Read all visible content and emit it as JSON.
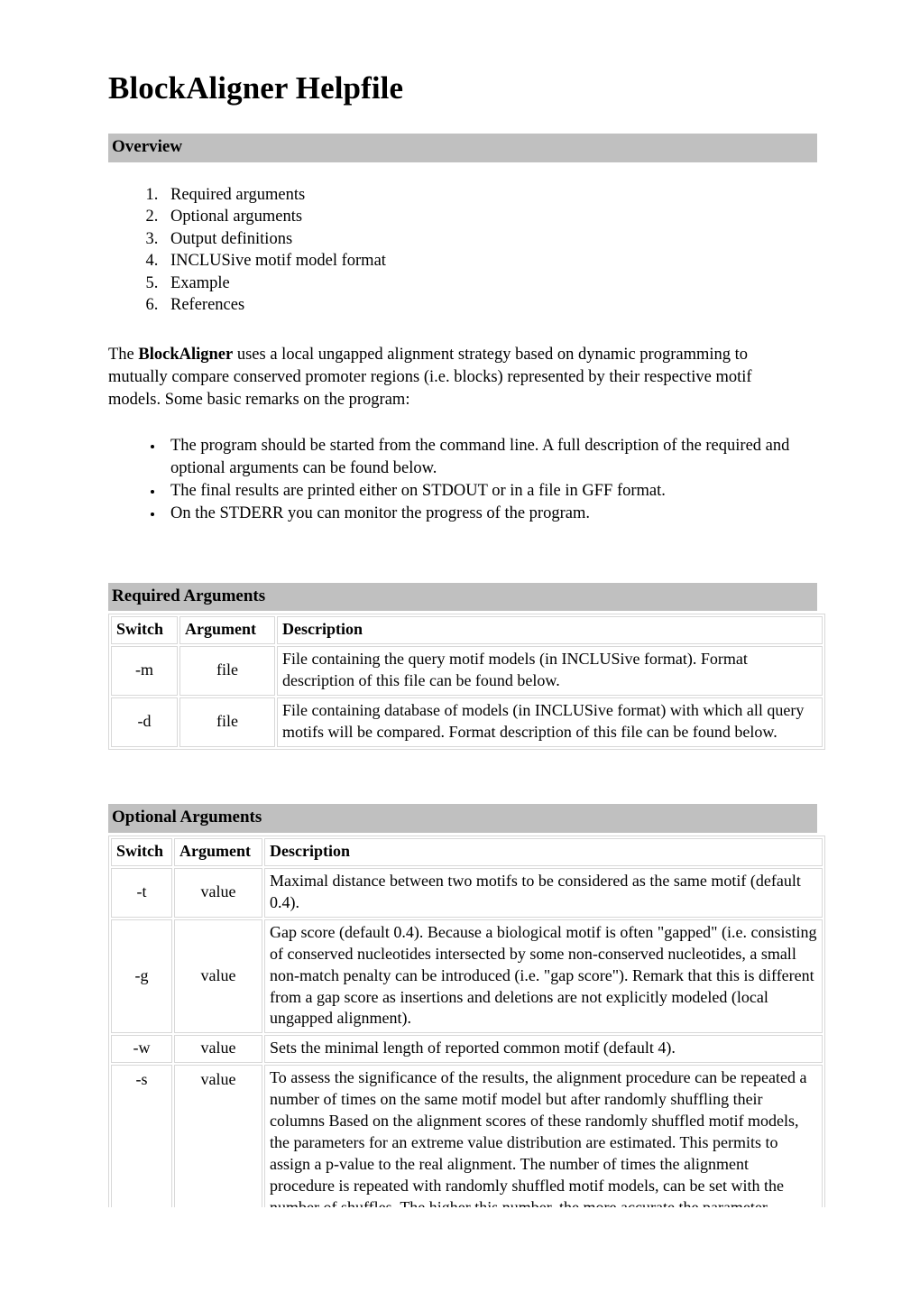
{
  "document": {
    "title": "BlockAligner Helpfile"
  },
  "overview": {
    "heading": "Overview",
    "items": [
      "Required arguments",
      "Optional arguments",
      "Output definitions",
      "INCLUSive motif model format",
      "Example",
      "References"
    ],
    "intro_prefix": "The ",
    "intro_bold": "BlockAligner",
    "intro_rest": " uses a local ungapped alignment strategy based on dynamic programming to mutually compare conserved promoter regions (i.e. blocks) represented by their respective motif models. Some basic remarks on the program:",
    "remarks": [
      "The program should be started from the command line. A full description of the required and optional arguments can be found below.",
      "The final results are printed either on STDOUT or in a file in GFF format.",
      "On the STDERR you can monitor the progress of the program."
    ]
  },
  "required_arguments": {
    "heading": "Required Arguments",
    "columns": [
      "Switch",
      "Argument",
      "Description"
    ],
    "rows": [
      {
        "switch": "-m",
        "argument": "file",
        "description": "File containing the query motif models (in INCLUSive format). Format description of this file can be found below."
      },
      {
        "switch": "-d",
        "argument": "file",
        "description": "File containing database of models (in INCLUSive format) with which all query motifs will be compared. Format description of this file can be found below."
      }
    ]
  },
  "optional_arguments": {
    "heading": "Optional Arguments",
    "columns": [
      "Switch",
      "Argument",
      "Description"
    ],
    "rows": [
      {
        "switch": "-t",
        "argument": "value",
        "description": "Maximal distance between two motifs to be considered as the same motif (default 0.4)."
      },
      {
        "switch": "-g",
        "argument": "value",
        "description": "Gap score (default 0.4). Because a biological motif is often \"gapped\" (i.e. consisting of conserved nucleotides intersected by some non-conserved nucleotides, a small non-match penalty can be introduced (i.e. \"gap score\"). Remark that this is different from a gap score as insertions and deletions are not explicitly modeled (local ungapped alignment)."
      },
      {
        "switch": "-w",
        "argument": "value",
        "description": "Sets the minimal length of reported common motif (default 4)."
      },
      {
        "switch": "-s",
        "argument": "value",
        "description": "To assess the significance of the results, the alignment procedure can be repeated a number of times on the same motif model but after randomly shuffling their columns Based on the alignment scores of these randomly shuffled motif models, the parameters for an extreme value distribution are estimated. This permits to assign a p-value to the real alignment. The number of times the alignment procedure is repeated with randomly shuffled motif models, can be set with the number of shuffles. The higher this number, the more accurate the parameter estimation of the extreme"
      }
    ]
  },
  "colors": {
    "section_banner": "#c0c0c0",
    "table_border": "#d8d8d8",
    "text": "#000000",
    "page_background": "#ffffff"
  }
}
